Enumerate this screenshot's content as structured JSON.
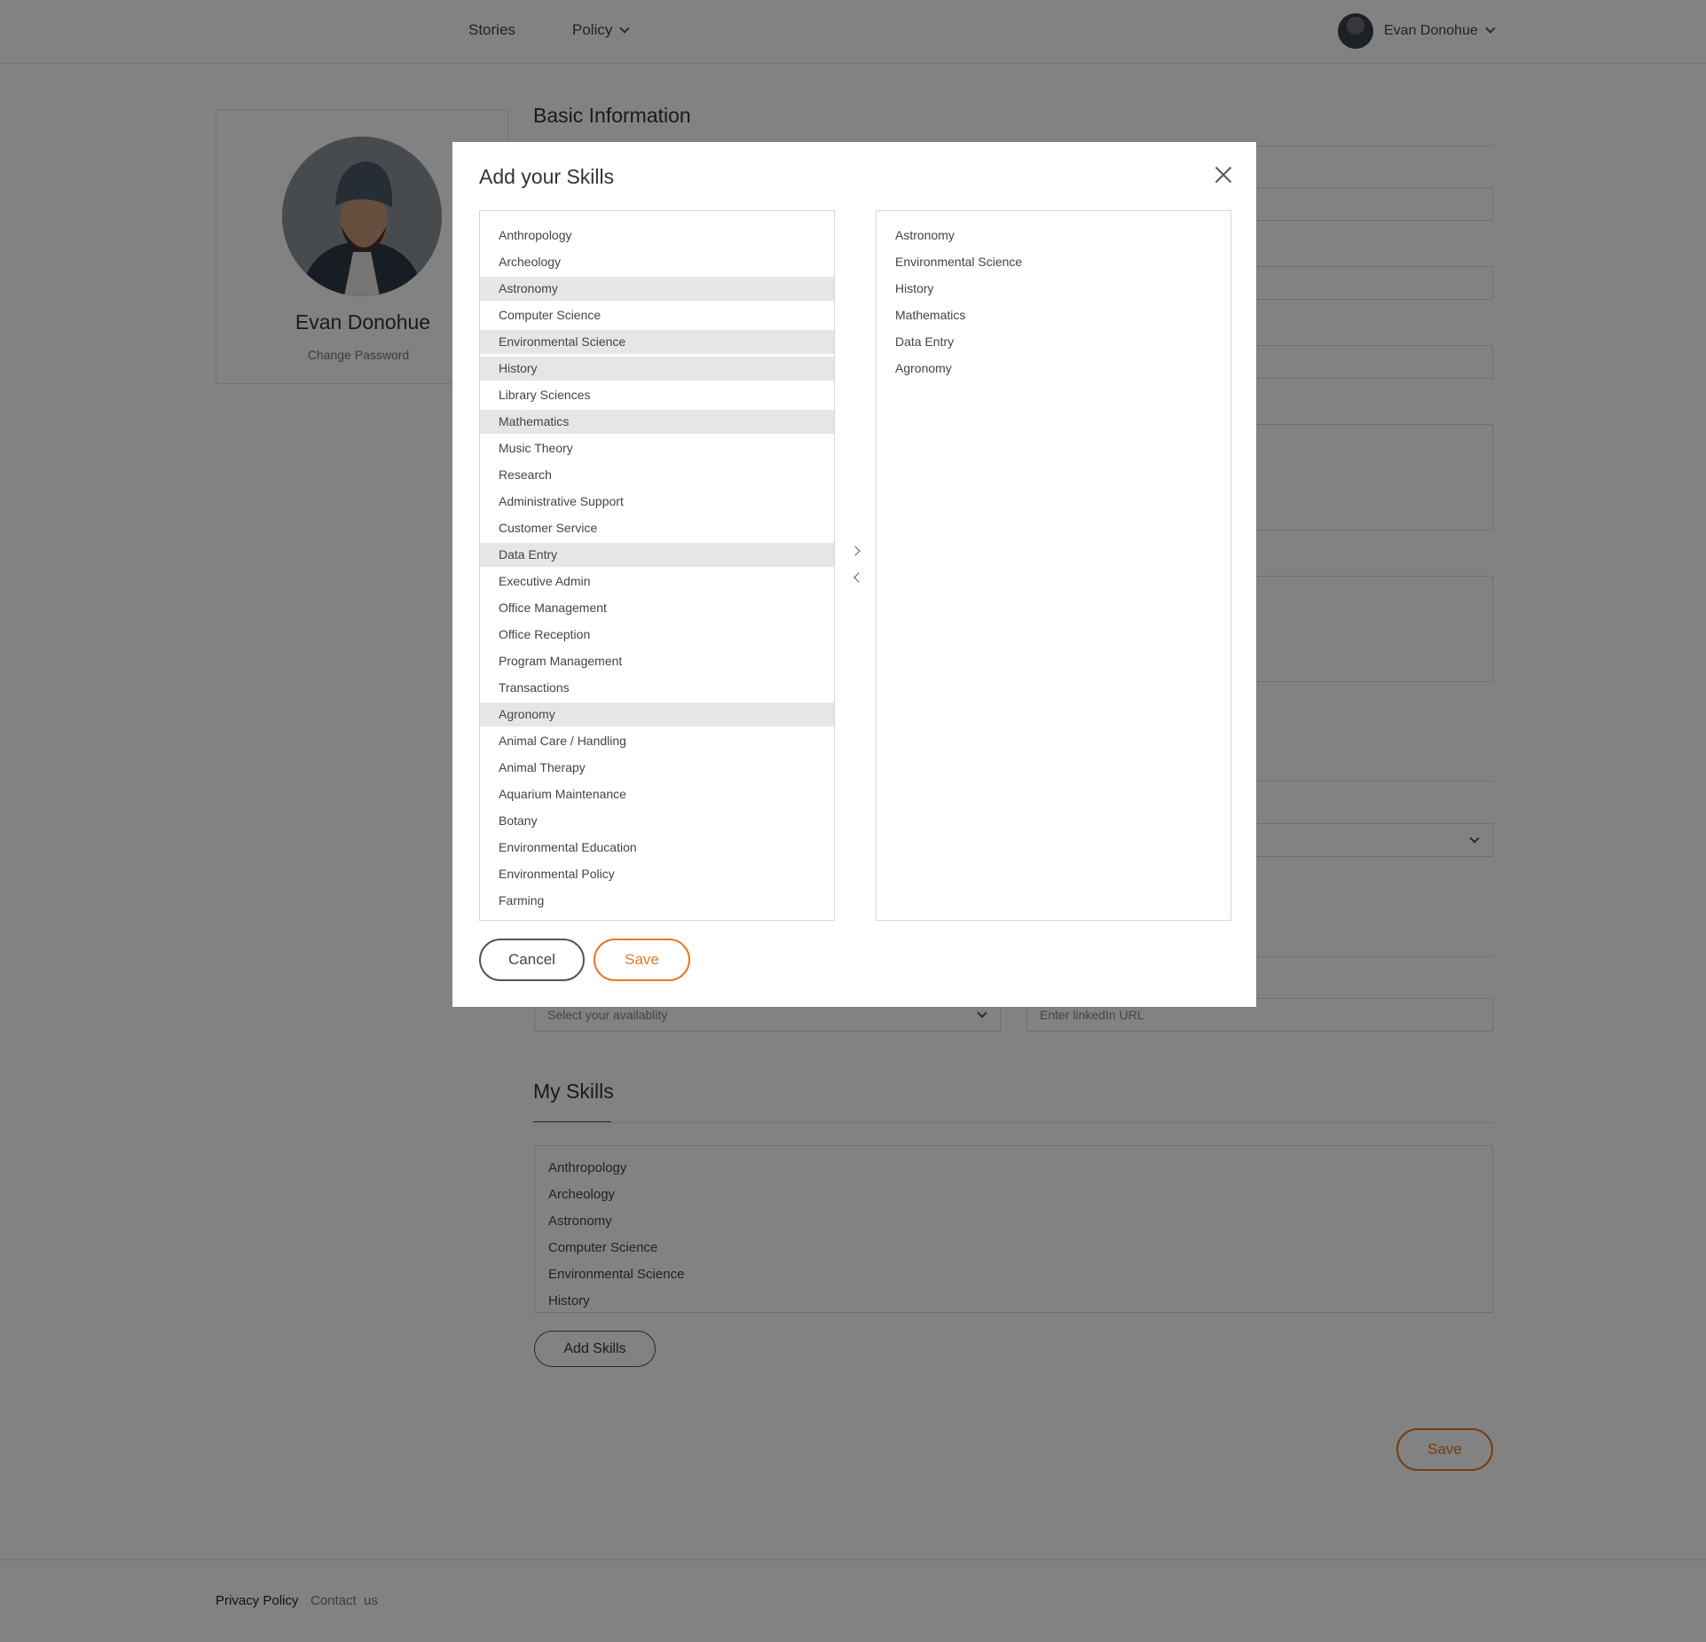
{
  "nav": {
    "stories": "Stories",
    "policy": "Policy",
    "user_name": "Evan Donohue"
  },
  "profile": {
    "name": "Evan Donohue",
    "change_password": "Change Password"
  },
  "main": {
    "basic_info_title": "Basic Information",
    "availability_placeholder": "Select your availablity",
    "linkedin_placeholder": "Enter linkedIn URL",
    "my_skills_title": "My Skills",
    "my_skills": [
      "Anthropology",
      "Archeology",
      "Astronomy",
      "Computer Science",
      "Environmental Science",
      "History"
    ],
    "add_skills_label": "Add Skills",
    "save_label": "Save"
  },
  "modal": {
    "title": "Add your Skills",
    "available_skills": [
      {
        "label": "Anthropology",
        "selected": false
      },
      {
        "label": "Archeology",
        "selected": false
      },
      {
        "label": "Astronomy",
        "selected": true
      },
      {
        "label": "Computer Science",
        "selected": false
      },
      {
        "label": "Environmental Science",
        "selected": true
      },
      {
        "label": "History",
        "selected": true
      },
      {
        "label": "Library Sciences",
        "selected": false
      },
      {
        "label": "Mathematics",
        "selected": true
      },
      {
        "label": "Music Theory",
        "selected": false
      },
      {
        "label": "Research",
        "selected": false
      },
      {
        "label": "Administrative Support",
        "selected": false
      },
      {
        "label": "Customer Service",
        "selected": false
      },
      {
        "label": "Data Entry",
        "selected": true
      },
      {
        "label": "Executive Admin",
        "selected": false
      },
      {
        "label": "Office Management",
        "selected": false
      },
      {
        "label": "Office Reception",
        "selected": false
      },
      {
        "label": "Program Management",
        "selected": false
      },
      {
        "label": "Transactions",
        "selected": false
      },
      {
        "label": "Agronomy",
        "selected": true
      },
      {
        "label": "Animal Care / Handling",
        "selected": false
      },
      {
        "label": "Animal Therapy",
        "selected": false
      },
      {
        "label": "Aquarium Maintenance",
        "selected": false
      },
      {
        "label": "Botany",
        "selected": false
      },
      {
        "label": "Environmental Education",
        "selected": false
      },
      {
        "label": "Environmental Policy",
        "selected": false
      },
      {
        "label": "Farming",
        "selected": false
      }
    ],
    "chosen_skills": [
      "Astronomy",
      "Environmental Science",
      "History",
      "Mathematics",
      "Data Entry",
      "Agronomy"
    ],
    "cancel_label": "Cancel",
    "save_label": "Save"
  },
  "footer": {
    "privacy": "Privacy Policy",
    "contact": "Contact  us"
  },
  "colors": {
    "accent": "#e87722",
    "overlay": "rgba(0,0,0,0.49)",
    "selected_row": "#e6e6e6"
  }
}
